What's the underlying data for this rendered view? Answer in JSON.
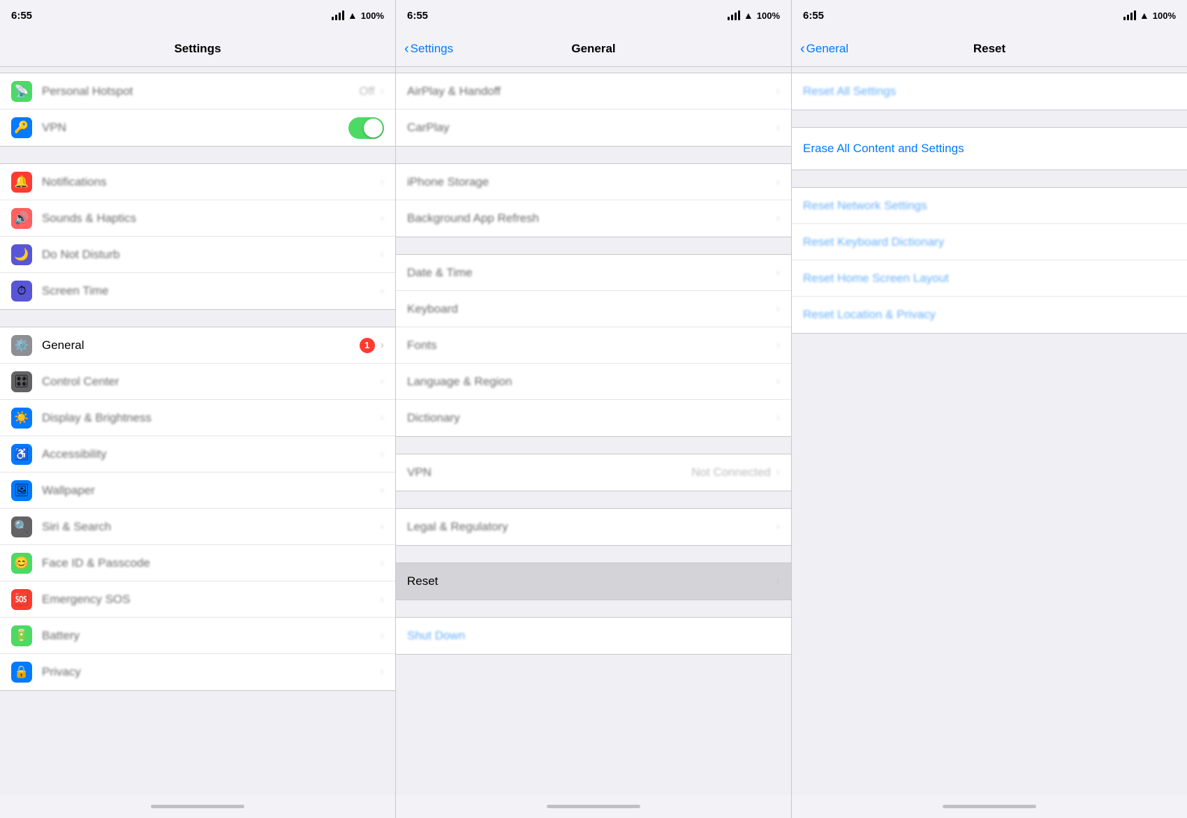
{
  "colors": {
    "accent": "#007aff",
    "destructive": "#ff3b30",
    "green": "#4cd964",
    "iconGray": "#8e8e93"
  },
  "panels": {
    "left": {
      "statusBar": {
        "time": "6:55",
        "signal": true,
        "wifi": true,
        "battery": "100"
      },
      "navTitle": "Settings",
      "sections": [
        {
          "rows": [
            {
              "icon": "🟩",
              "iconBg": "#4cd964",
              "label": "Personal Hotspot",
              "value": "Off",
              "hasChevron": true
            },
            {
              "icon": "📶",
              "iconBg": "#007aff",
              "label": "VPN",
              "toggle": true,
              "toggleOn": true,
              "hasChevron": false
            }
          ]
        },
        {
          "rows": [
            {
              "icon": "🔔",
              "iconBg": "#ff3b30",
              "label": "Notifications",
              "hasChevron": true
            },
            {
              "icon": "🔊",
              "iconBg": "#ff6b6b",
              "label": "Sounds & Haptics",
              "hasChevron": true
            },
            {
              "icon": "🌙",
              "iconBg": "#5856d6",
              "label": "Do Not Disturb",
              "hasChevron": true
            },
            {
              "icon": "⏱",
              "iconBg": "#5856d6",
              "label": "Screen Time",
              "hasChevron": true
            }
          ]
        },
        {
          "rows": [
            {
              "icon": "⚙️",
              "iconBg": "#8e8e93",
              "label": "General",
              "badge": "1",
              "hasChevron": true,
              "selected": true
            },
            {
              "icon": "🎛",
              "iconBg": "#636366",
              "label": "Control Center",
              "hasChevron": true
            },
            {
              "icon": "☀️",
              "iconBg": "#007aff",
              "label": "Display & Brightness",
              "hasChevron": true
            },
            {
              "icon": "♿",
              "iconBg": "#007aff",
              "label": "Accessibility",
              "hasChevron": true
            },
            {
              "icon": "🖼",
              "iconBg": "#007aff",
              "label": "Wallpaper",
              "hasChevron": true
            },
            {
              "icon": "🔍",
              "iconBg": "#636366",
              "label": "Siri & Search",
              "hasChevron": true
            },
            {
              "icon": "😊",
              "iconBg": "#4cd964",
              "label": "Face ID & Passcode",
              "hasChevron": true
            },
            {
              "icon": "🆘",
              "iconBg": "#ff3b30",
              "label": "Emergency SOS",
              "hasChevron": true
            },
            {
              "icon": "🔋",
              "iconBg": "#4cd964",
              "label": "Battery",
              "hasChevron": true
            },
            {
              "icon": "🔒",
              "iconBg": "#007aff",
              "label": "Privacy",
              "hasChevron": true
            }
          ]
        }
      ]
    },
    "mid": {
      "statusBar": {
        "time": "6:55"
      },
      "navBack": "Settings",
      "navTitle": "General",
      "sections": [
        {
          "rows": [
            {
              "label": "AirPlay & Handoff",
              "hasChevron": true
            },
            {
              "label": "CarPlay",
              "hasChevron": true
            }
          ]
        },
        {
          "rows": [
            {
              "label": "iPhone Storage",
              "hasChevron": true
            },
            {
              "label": "Background App Refresh",
              "hasChevron": true
            }
          ]
        },
        {
          "rows": [
            {
              "label": "Date & Time",
              "hasChevron": true
            },
            {
              "label": "Keyboard",
              "hasChevron": true
            },
            {
              "label": "Fonts",
              "hasChevron": true
            },
            {
              "label": "Language & Region",
              "hasChevron": true
            },
            {
              "label": "Dictionary",
              "hasChevron": true
            }
          ]
        },
        {
          "rows": [
            {
              "label": "VPN",
              "value": "Not Connected",
              "hasChevron": true
            }
          ]
        },
        {
          "rows": [
            {
              "label": "Legal & Regulatory",
              "hasChevron": true
            }
          ]
        },
        {
          "rows": [
            {
              "label": "Reset",
              "hasChevron": true,
              "highlight": true
            }
          ]
        },
        {
          "rows": [
            {
              "label": "Shut Down",
              "isBlue": true
            }
          ]
        }
      ]
    },
    "right": {
      "statusBar": {
        "time": "6:55"
      },
      "navBack": "General",
      "navTitle": "Reset",
      "rows": [
        {
          "label": "Reset All Settings",
          "isBlue": true,
          "blurred": true
        },
        {
          "label": "Erase All Content and Settings",
          "isBlue": false,
          "highlight": true
        },
        {
          "label": "Reset Network Settings",
          "isBlue": true,
          "blurred": true
        },
        {
          "label": "Reset Keyboard Dictionary",
          "isBlue": true,
          "blurred": true
        },
        {
          "label": "Reset Home Screen Layout",
          "isBlue": true,
          "blurred": true
        },
        {
          "label": "Reset Location & Privacy",
          "isBlue": true,
          "blurred": true
        }
      ]
    }
  }
}
